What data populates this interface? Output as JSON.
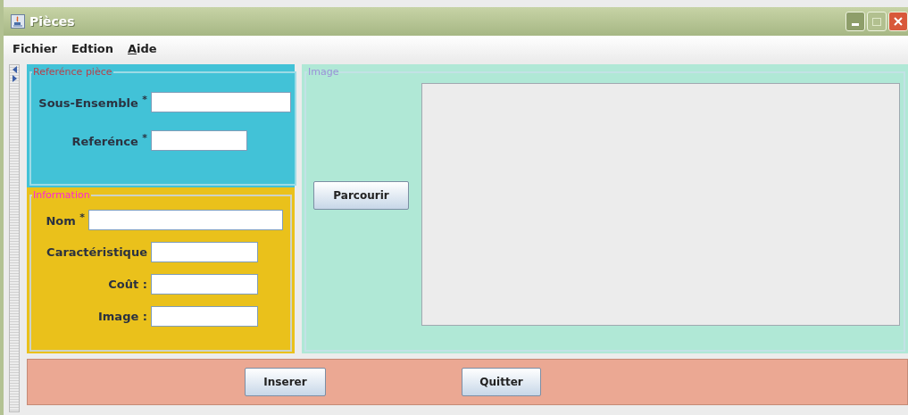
{
  "window": {
    "title": "Pièces"
  },
  "menu": [
    {
      "label": "Fichier",
      "mnemonic": false
    },
    {
      "label": "Edtion",
      "mnemonic": false
    },
    {
      "label": "Aide",
      "mnemonic": true
    }
  ],
  "reference_panel": {
    "title": "Referénce pièce",
    "fields": [
      {
        "label": "Sous-Ensemble $^{*}$"
      },
      {
        "label": "Referénce $^{*}$"
      }
    ]
  },
  "information_panel": {
    "title": "Information",
    "fields": [
      {
        "label": "Nom $^{*}$"
      },
      {
        "label": "Caractéristique"
      },
      {
        "label": "Coût :"
      },
      {
        "label": "Image :"
      }
    ]
  },
  "image_panel": {
    "title": "Image",
    "button": "Parcourir"
  },
  "buttons": [
    "Inserer",
    "Quitter"
  ]
}
